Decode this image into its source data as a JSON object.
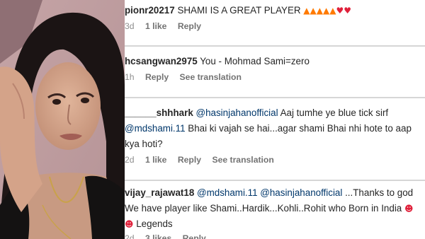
{
  "comments": [
    {
      "username": "pionr20217",
      "text": " SHAMI IS A GREAT PLAYER ",
      "emojis": [
        "fire-icon",
        "fire-icon",
        "fire-icon",
        "fire-icon",
        "fire-icon",
        "heart-icon",
        "heart-icon"
      ],
      "time": "3d",
      "likes": "1 like",
      "reply": "Reply"
    },
    {
      "username": "hcsangwan2975",
      "text": " You - Mohmad Sami=zero",
      "time": "1h",
      "reply": "Reply",
      "translate": "See translation"
    },
    {
      "username": "______shhhark",
      "mention1": " @hasinjahanofficial",
      "text1": " Aaj tumhe ye blue tick sirf",
      "mention2": "@mdshami.11",
      "text2": " Bhai ki vajah se hai...agar shami Bhai nhi hote to aap kya hoti?",
      "time": "2d",
      "likes": "1 like",
      "reply": "Reply",
      "translate": "See translation"
    },
    {
      "username": "vijay_rajawat18",
      "mention1": " @mdshami.11",
      "mention2": " @hasinjahanofficial",
      "text": " ...Thanks to god We have player like Shami..Hardik...Kohli..Rohit who Born in India ",
      "emojis": [
        "smiling-face-with-hearts-icon",
        "heart-eyes-icon"
      ],
      "text_end": " Legends",
      "time": "2d",
      "likes": "3 likes",
      "reply": "Reply"
    }
  ],
  "colors": {
    "text": "#262626",
    "mention": "#00376b",
    "meta": "#8e8e8e",
    "fire": "#ff7a00",
    "heart": "#e0203a"
  }
}
